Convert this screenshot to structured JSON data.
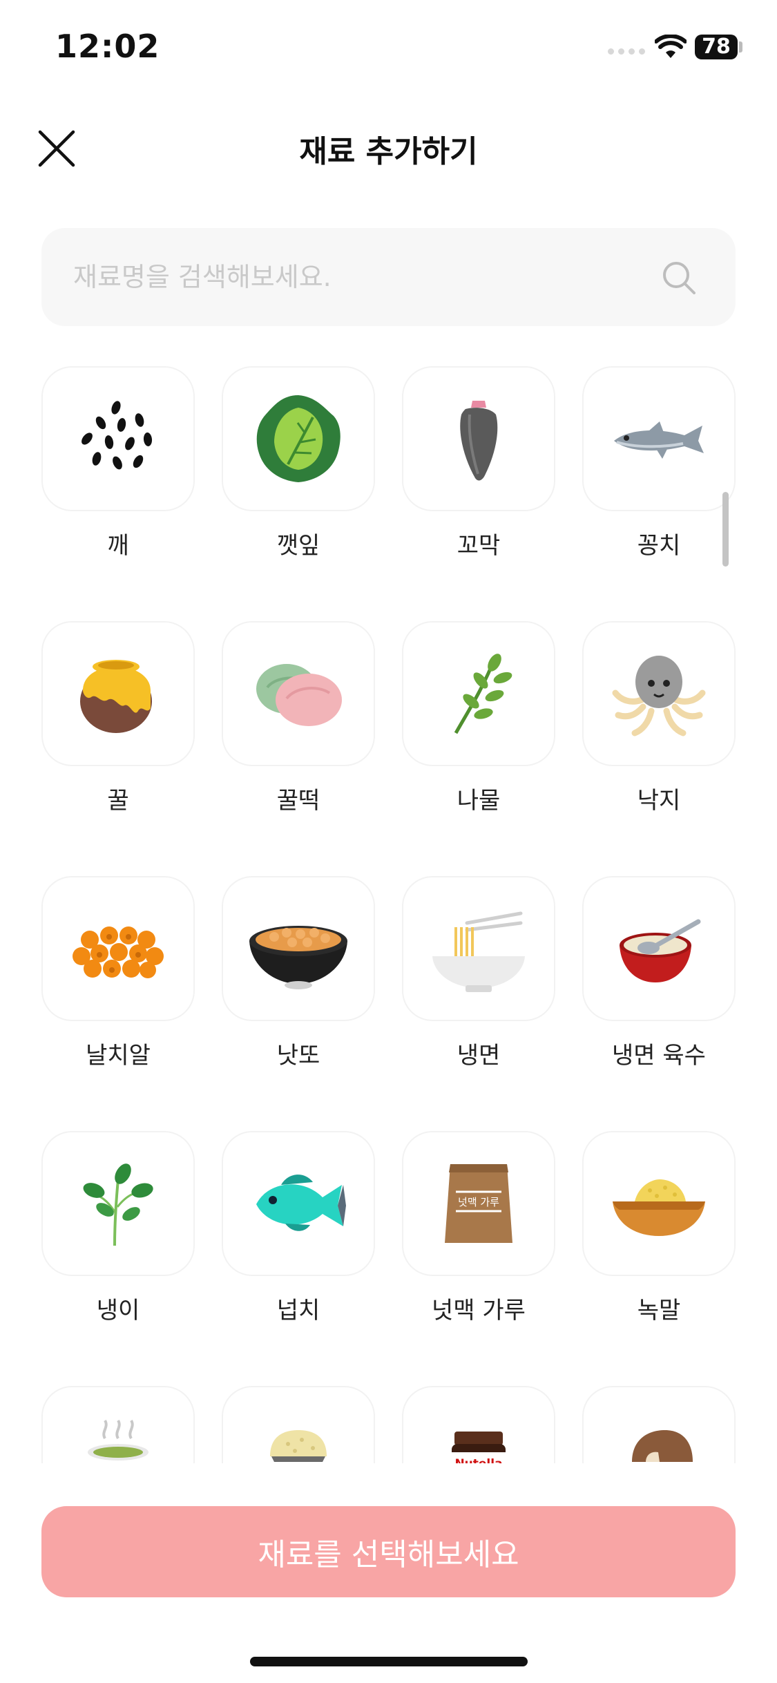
{
  "status_bar": {
    "time": "12:02",
    "battery": "78"
  },
  "header": {
    "title": "재료 추가하기",
    "close_icon": "close-icon"
  },
  "search": {
    "placeholder": "재료명을 검색해보세요.",
    "value": "",
    "icon": "search-icon"
  },
  "ingredients": [
    {
      "name": "깨",
      "icon": "sesame-icon"
    },
    {
      "name": "깻잎",
      "icon": "perilla-leaf-icon"
    },
    {
      "name": "꼬막",
      "icon": "cockle-icon"
    },
    {
      "name": "꽁치",
      "icon": "saury-fish-icon"
    },
    {
      "name": "꿀",
      "icon": "honey-pot-icon"
    },
    {
      "name": "꿀떡",
      "icon": "honey-rice-cake-icon"
    },
    {
      "name": "나물",
      "icon": "herb-sprig-icon"
    },
    {
      "name": "낙지",
      "icon": "octopus-icon"
    },
    {
      "name": "날치알",
      "icon": "flying-fish-roe-icon"
    },
    {
      "name": "낫또",
      "icon": "natto-bowl-icon"
    },
    {
      "name": "냉면",
      "icon": "noodle-bowl-icon"
    },
    {
      "name": "냉면 육수",
      "icon": "broth-bowl-icon"
    },
    {
      "name": "냉이",
      "icon": "shepherds-purse-icon"
    },
    {
      "name": "넙치",
      "icon": "flatfish-icon"
    },
    {
      "name": "넛맥 가루",
      "icon": "nutmeg-powder-bag-icon",
      "label_on_icon": "넛맥 가루"
    },
    {
      "name": "녹말",
      "icon": "starch-bowl-icon"
    },
    {
      "name": "",
      "icon": "soup-icon"
    },
    {
      "name": "",
      "icon": "rice-ball-icon"
    },
    {
      "name": "",
      "icon": "nutella-jar-icon",
      "label_on_icon": "Nutella"
    },
    {
      "name": "",
      "icon": "mushroom-icon"
    }
  ],
  "cta": {
    "label": "재료를 선택해보세요"
  }
}
